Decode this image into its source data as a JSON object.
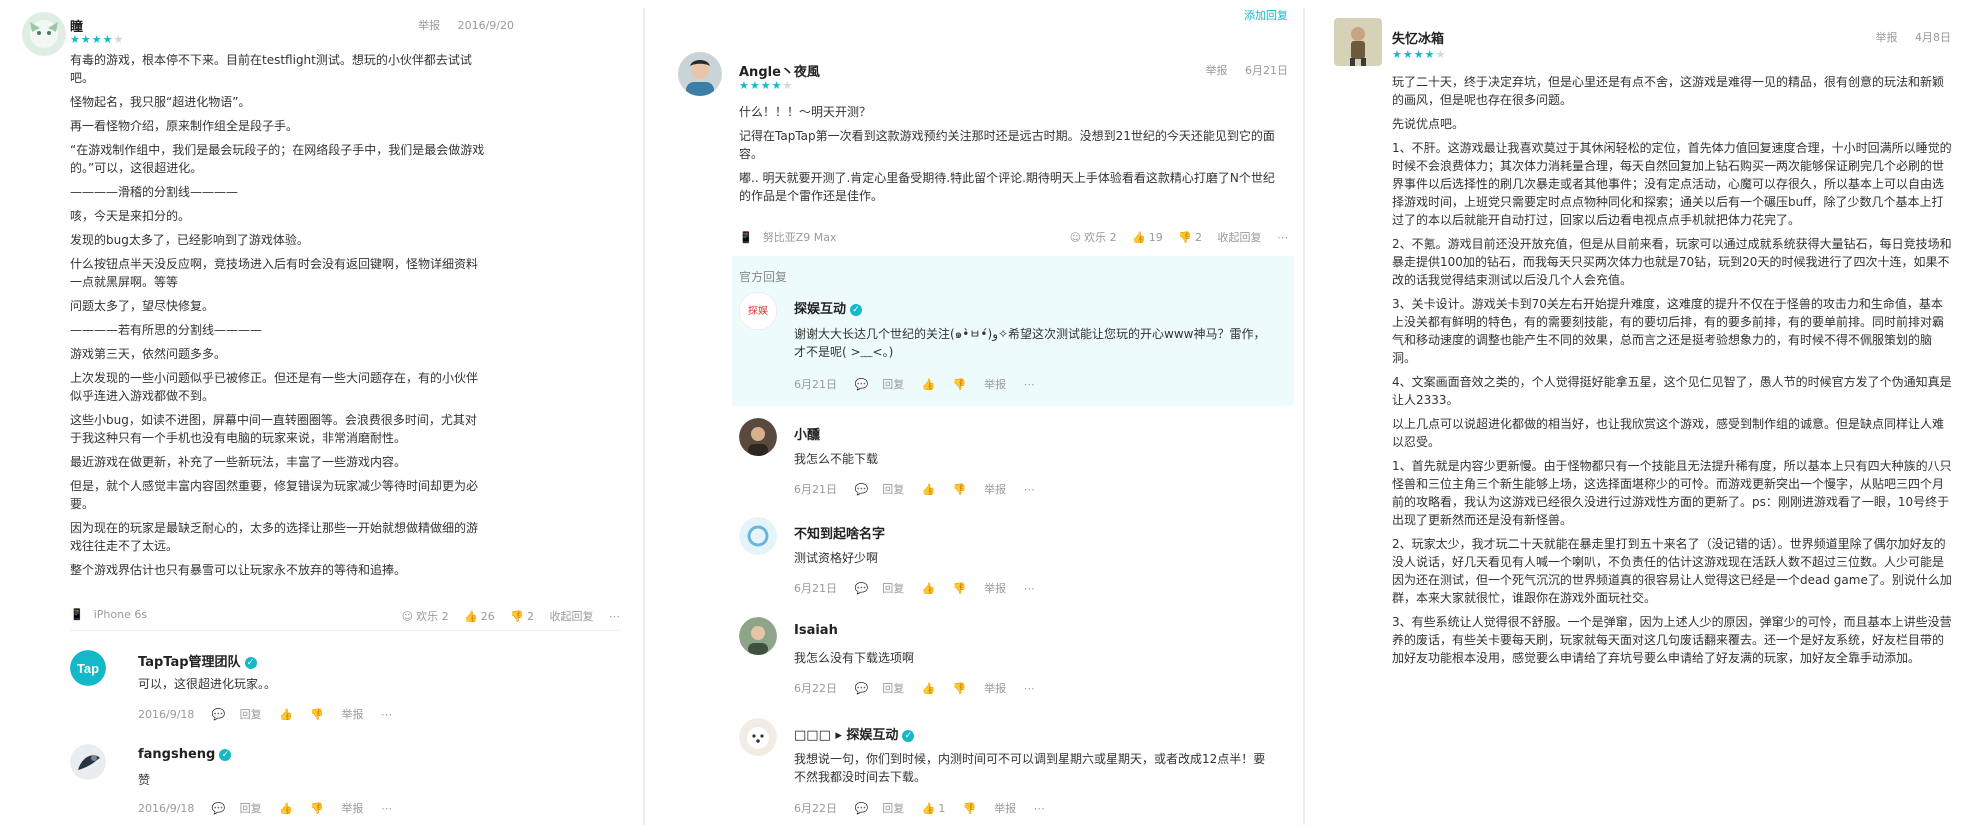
{
  "actions": {
    "report": "举报",
    "reply": "回复",
    "collapse": "收起回复",
    "add_reply": "添加回复",
    "official_reply": "官方回复"
  },
  "icons": {
    "thumb_up": "👍",
    "thumb_down": "👎",
    "reply_bubble": "💬",
    "phone": "📱",
    "smile": "☺",
    "more": "⋯"
  },
  "colors": {
    "accent": "#14b9c8",
    "star_off": "#d6d6d6"
  },
  "left": {
    "review": {
      "author": "瞳",
      "rating": 4,
      "date": "2016/9/20",
      "paragraphs": [
        "有毒的游戏，根本停不下来。目前在testflight测试。想玩的小伙伴都去试试吧。",
        "怪物起名，我只服“超进化物语”。",
        "再一看怪物介绍，原来制作组全是段子手。",
        "“在游戏制作组中，我们是最会玩段子的；在网络段子手中，我们是最会做游戏的。”可以，这很超进化。",
        "————滑稽的分割线————",
        "咳，今天是来扣分的。",
        "发现的bug太多了，已经影响到了游戏体验。",
        "什么按钮点半天没反应啊，竞技场进入后有时会没有返回键啊，怪物详细资料一点就黑屏啊。等等",
        "问题太多了，望尽快修复。",
        "————若有所思的分割线————",
        "游戏第三天，依然问题多多。",
        "上次发现的一些小问题似乎已被修正。但还是有一些大问题存在，有的小伙伴似乎连进入游戏都做不到。",
        "这些小bug，如读不进图，屏幕中间一直转圈圈等。会浪费很多时间，尤其对于我这种只有一个手机也没有电脑的玩家来说，非常消磨耐性。",
        "最近游戏在做更新，补充了一些新玩法，丰富了一些游戏内容。",
        "但是，就个人感觉丰富内容固然重要，修复错误为玩家减少等待时间却更为必要。",
        "因为现在的玩家是最缺乏耐心的，太多的选择让那些一开始就想做精做细的游戏往往走不了太远。",
        "整个游戏界估计也只有暴雪可以让玩家永不放弃的等待和追捧。"
      ],
      "device": "iPhone 6s",
      "stats": {
        "fun": "欢乐 2",
        "up": "26",
        "down": "2"
      }
    },
    "replies": [
      {
        "author": "TapTap管理团队",
        "text": "可以，这很超进化玩家。。",
        "date": "2016/9/18"
      },
      {
        "author": "fangsheng",
        "text": "赞",
        "date": "2016/9/18"
      }
    ]
  },
  "middle": {
    "review": {
      "author": "Angle丶夜風",
      "rating": 4,
      "date": "6月21日",
      "paragraphs": [
        "什么！！！～明天开测？",
        "记得在TapTap第一次看到这款游戏预约关注那时还是远古时期。没想到21世纪的今天还能见到它的面容。",
        "嘟.. 明天就要开测了.肯定心里备受期待.特此留个评论.期待明天上手体验看看这款精心打磨了N个世纪的作品是个雷作还是佳作。"
      ],
      "device": "努比亚Z9 Max",
      "stats": {
        "fun": "欢乐 2",
        "up": "19",
        "down": "2"
      }
    },
    "official": {
      "author": "探娱互动",
      "text": "谢谢大大长达几个世纪的关注(๑•̀ㅂ•́)و✧希望这次测试能让您玩的开心www神马？雷作，才不是呢( >﹏<。)",
      "date": "6月21日"
    },
    "replies": [
      {
        "author": "小醺",
        "text": "我怎么不能下载",
        "date": "6月21日",
        "up": ""
      },
      {
        "author": "不知到起啥名字",
        "text": "测试资格好少啊",
        "date": "6月21日",
        "up": ""
      },
      {
        "author": "Isaiah",
        "text": "我怎么没有下载选项啊",
        "date": "6月22日",
        "up": ""
      },
      {
        "author": "□□□ ▸ 探娱互动",
        "text": "我想说一句，你们到时候，内测时间可不可以调到星期六或星期天，或者改成12点半！要不然我都没时间去下载。",
        "date": "6月22日",
        "up": "1"
      }
    ]
  },
  "right": {
    "review": {
      "author": "失忆冰箱",
      "rating": 4,
      "date": "4月8日",
      "paragraphs": [
        "玩了二十天，终于决定弃坑，但是心里还是有点不舍，这游戏是难得一见的精品，很有创意的玩法和新颖的画风，但是呢也存在很多问题。",
        "先说优点吧。",
        "1、不肝。这游戏最让我喜欢莫过于其休闲轻松的定位，首先体力值回复速度合理，十小时回满所以睡觉的时候不会浪费体力；其次体力消耗量合理，每天自然回复加上钻石购买一两次能够保证刷完几个必刷的世界事件以后选择性的刷几次暴走或者其他事件；没有定点活动，心魔可以存很久，所以基本上可以自由选择游戏时间，上班党只需要定时点点物种同化和探索；通关以后有一个碾压buff，除了少数几个基本上打过了的本以后就能开自动打过，回家以后边看电视点点手机就把体力花完了。",
        "2、不氪。游戏目前还没开放充值，但是从目前来看，玩家可以通过成就系统获得大量钻石，每日竞技场和暴走提供100加的钻石，而我每天只买两次体力也就是70钻，玩到20天的时候我进行了四次十连，如果不改的话我觉得结束测试以后没几个人会充值。",
        "3、关卡设计。游戏关卡到70关左右开始提升难度，这难度的提升不仅在于怪兽的攻击力和生命值，基本上没关都有鲜明的特色，有的需要刻技能，有的要切后排，有的要多前排，有的要单前排。同时前排对霸气和移动速度的调整也能产生不同的效果，总而言之还是挺考验想象力的，有时候不得不佩服策划的脑洞。",
        "4、文案画面音效之类的，个人觉得挺好能拿五星，这个见仁见智了，愚人节的时候官方发了个伪通知真是让人2333。",
        "以上几点可以说超进化都做的相当好，也让我欣赏这个游戏，感受到制作组的诚意。但是缺点同样让人难以忍受。",
        "1、首先就是内容少更新慢。由于怪物都只有一个技能且无法提升稀有度，所以基本上只有四大种族的八只怪兽和三位主角三个新生能够上场，这选择面堪称少的可怜。而游戏更新突出一个慢字，从贴吧三四个月前的攻略看，我认为这游戏已经很久没进行过游戏性方面的更新了。ps：刚刚进游戏看了一眼，10号终于出现了更新然而还是没有新怪兽。",
        "2、玩家太少，我才玩二十天就能在暴走里打到五十来名了（没记错的话）。世界频道里除了偶尔加好友的没人说话，好几天看见有人喊一个喇叭，不负责任的估计这游戏现在活跃人数不超过三位数。人少可能是因为还在测试，但一个死气沉沉的世界频道真的很容易让人觉得这已经是一个dead game了。别说什么加群，本来大家就很忙，谁跟你在游戏外面玩社交。",
        "3、有些系统让人觉得很不舒服。一个是弹窜，因为上述人少的原因，弹窜少的可怜，而且基本上讲些没营养的废话，有些关卡要每天刷，玩家就每天面对这几句废话翻来覆去。还一个是好友系统，好友栏目带的加好友功能根本没用，感觉要么申请给了弃坑号要么申请给了好友满的玩家，加好友全靠手动添加。"
      ]
    }
  }
}
